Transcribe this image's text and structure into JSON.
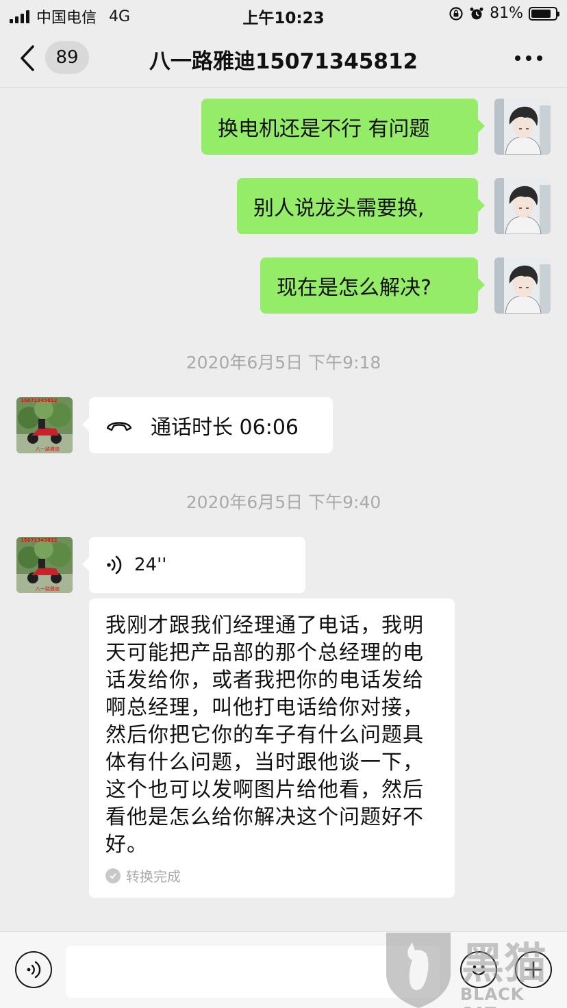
{
  "status_bar": {
    "carrier": "中国电信",
    "network": "4G",
    "time": "上午10:23",
    "battery_percent": "81%",
    "battery_level": 0.81
  },
  "nav": {
    "unread_count": "89",
    "title": "八一路雅迪15071345812"
  },
  "messages": {
    "out1": "换电机还是不行 有问题",
    "out2": "别人说龙头需要换,",
    "out3": "现在是怎么解决?",
    "ts1": "2020年6月5日 下午9:18",
    "call_label": "通话时长 06:06",
    "ts2": "2020年6月5日 下午9:40",
    "voice_duration": "24''",
    "transcript": "我刚才跟我们经理通了电话，我明天可能把产品部的那个总经理的电话发给你，或者我把你的电话发给啊总经理，叫他打电话给你对接，然后你把它你的车子有什么问题具体有什么问题，当时跟他谈一下，这个也可以发啊图片给他看，然后看他是怎么给你解决这个问题好不好。",
    "transcript_status": "转换完成"
  },
  "contact_avatar": {
    "number": "15071345812",
    "label": "八一路雅迪"
  },
  "watermark": {
    "cn": "黑猫",
    "en": "BLACK CAT"
  },
  "colors": {
    "outgoing_bubble": "#95ec69",
    "incoming_bubble": "#ffffff",
    "background": "#ededed"
  }
}
